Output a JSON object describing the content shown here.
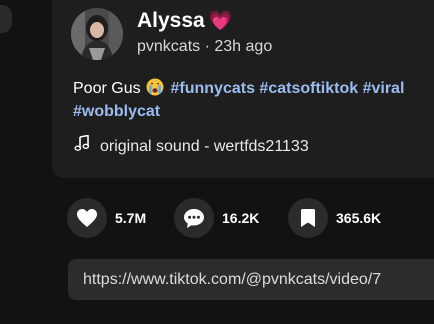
{
  "author": {
    "name": "Alyssa",
    "name_emoji": "💗",
    "username": "pvnkcats",
    "separator": "·",
    "time_ago": "23h ago"
  },
  "caption": {
    "text": "Poor Gus",
    "emoji": "crying-face",
    "hashtags": [
      "#funnycats",
      "#catsoftiktok",
      "#viral",
      "#wobblycat"
    ]
  },
  "sound": {
    "icon": "music-note-icon",
    "label": "original sound - wertfds21133"
  },
  "actions": {
    "likes": "5.7M",
    "comments": "16.2K",
    "saves": "365.6K"
  },
  "share_link": {
    "value": "https://www.tiktok.com/@pvnkcats/video/7"
  },
  "colors": {
    "background": "#121212",
    "card": "#1e1e1e",
    "hashtag": "#9bbcf0",
    "action_circle": "#2b2b2b",
    "link_box": "#2c2c2c"
  }
}
